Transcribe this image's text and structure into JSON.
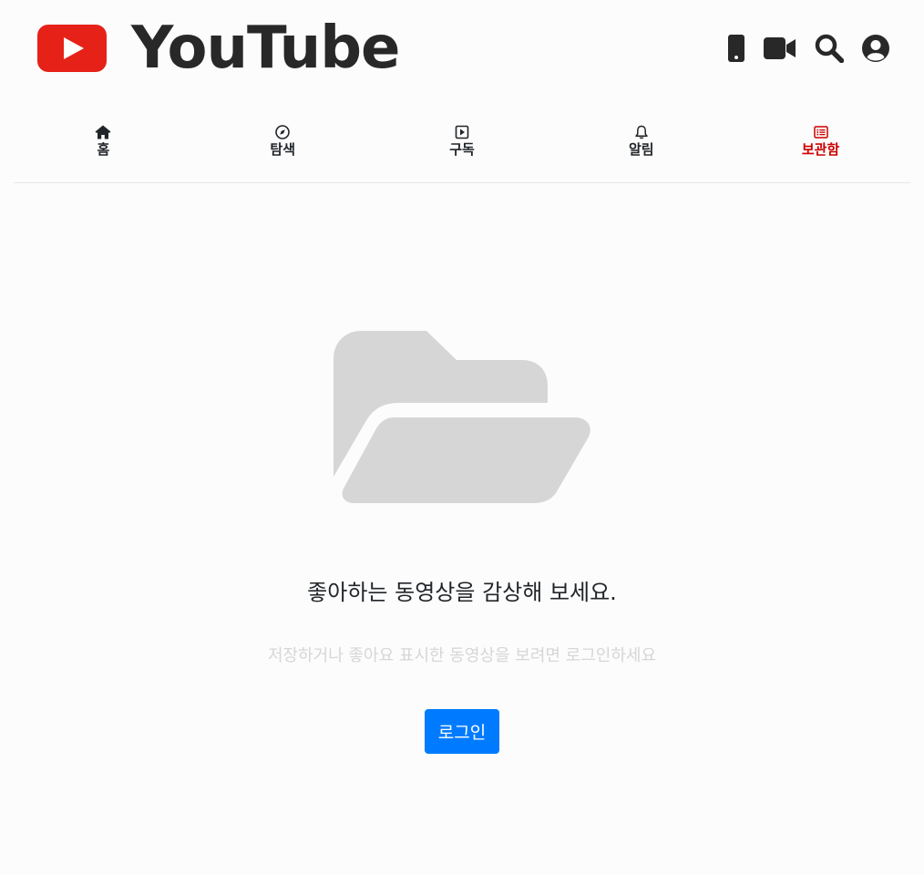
{
  "header": {
    "brand": "YouTube",
    "icons": [
      "smartphone-icon",
      "video-camera-icon",
      "search-icon",
      "user-account-icon"
    ]
  },
  "nav": {
    "items": [
      {
        "label": "홈",
        "icon": "home-icon"
      },
      {
        "label": "탐색",
        "icon": "compass-icon"
      },
      {
        "label": "구독",
        "icon": "subscriptions-icon"
      },
      {
        "label": "알림",
        "icon": "bell-icon"
      },
      {
        "label": "보관함",
        "icon": "library-icon",
        "active": true
      }
    ]
  },
  "empty_state": {
    "icon": "folder-open-icon",
    "title": "좋아하는 동영상을 감상해 보세요.",
    "description": "저장하거나 좋아요 표시한 동영상을 보려면 로그인하세요",
    "login_label": "로그인"
  },
  "colors": {
    "brand_red": "#e62117",
    "active_nav": "#cc0000",
    "primary_button": "#007bff",
    "folder_gray": "#d6d6d6"
  }
}
